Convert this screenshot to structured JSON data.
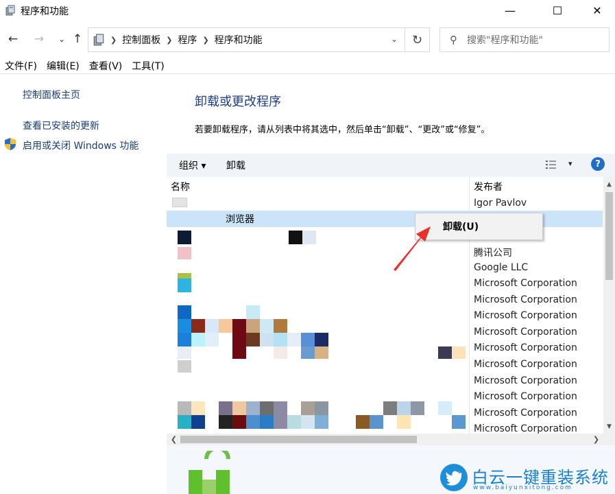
{
  "window": {
    "title": "程序和功能",
    "minimize_glyph": "—",
    "maximize_glyph": "☐",
    "close_glyph": "✕"
  },
  "nav": {
    "back_glyph": "←",
    "forward_glyph": "→",
    "recent_glyph": "⌄",
    "up_glyph": "↑",
    "breadcrumbs": [
      "控制面板",
      "程序",
      "程序和功能"
    ],
    "dropdown_glyph": "⌄",
    "refresh_glyph": "↻",
    "search_placeholder": "搜索\"程序和功能\""
  },
  "menu": [
    "文件(F)",
    "编辑(E)",
    "查看(V)",
    "工具(T)"
  ],
  "sidebar": {
    "home": "控制面板主页",
    "updates": "查看已安装的更新",
    "features": "启用或关闭 Windows 功能"
  },
  "main": {
    "title": "卸载或更改程序",
    "description": "若要卸载程序，请从列表中将其选中，然后单击“卸载”、“更改”或“修复”。"
  },
  "toolbar": {
    "organize": "组织 ▾",
    "uninstall": "卸载",
    "view_dropdown": "▾",
    "help": "?"
  },
  "list": {
    "col_name": "名称",
    "col_publisher": "发布者",
    "sort_glyph": "˄",
    "selected_name": "浏览器",
    "publishers": [
      "Igor Pavlov",
      "",
      "",
      "腾讯公司",
      "Google LLC",
      "Microsoft Corporation",
      "Microsoft Corporation",
      "Microsoft Corporation",
      "Microsoft Corporation",
      "Microsoft Corporation",
      "Microsoft Corporation",
      "Microsoft Corporation",
      "Microsoft Corporation",
      "Microsoft Corporation",
      "Microsoft Corporation"
    ]
  },
  "context_menu": {
    "uninstall": "卸载(U)"
  },
  "scroll": {
    "up": "▲",
    "down": "▼",
    "left": "❮",
    "right": "❯"
  },
  "watermark": {
    "text": "白云一键重装系统",
    "url": "www.baiyunxitong.com"
  },
  "colors": {
    "link": "#1a3e78",
    "title": "#1e3f88",
    "selection": "#cce4f7",
    "toolbar_bg": "#f0f4f9",
    "arrow": "#e8312a",
    "watermark": "#1c80d0"
  }
}
